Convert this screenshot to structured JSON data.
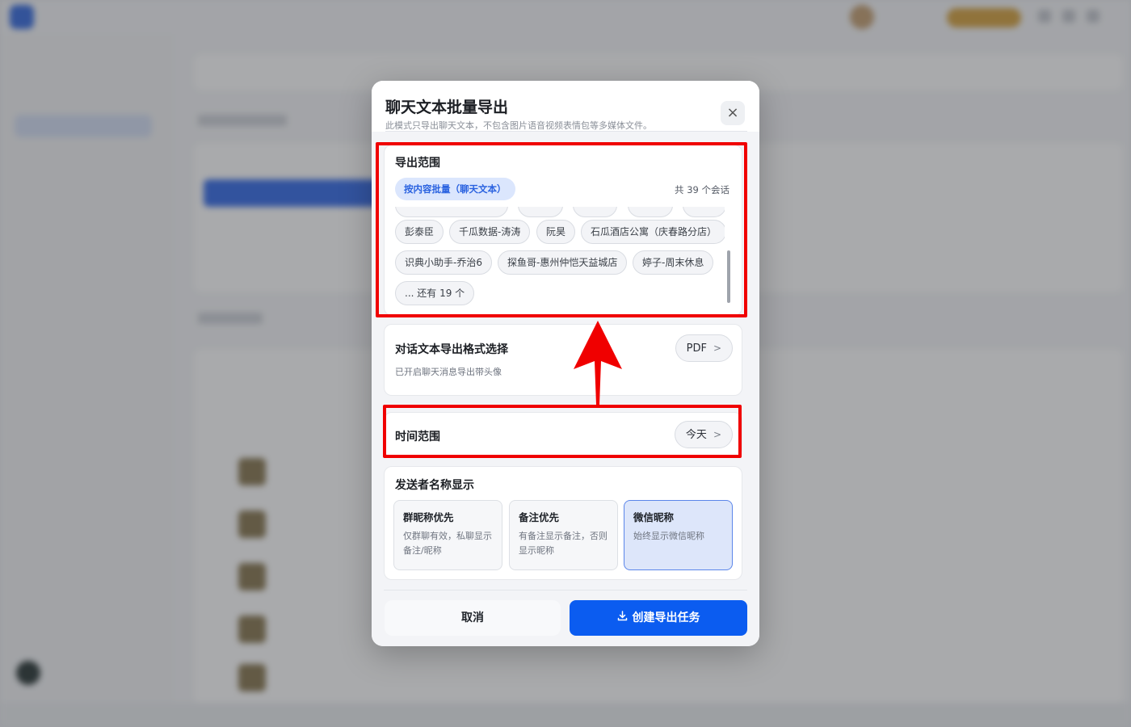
{
  "modal": {
    "title": "聊天文本批量导出",
    "subtitle": "此模式只导出聊天文本，不包含图片语音视频表情包等多媒体文件。",
    "close_icon": "×"
  },
  "export_range": {
    "title": "导出范围",
    "scope_label": "按内容批量（聊天文本）",
    "count_text": "共 39 个会话",
    "chips": [
      "彭泰臣",
      "千瓜数据-涛涛",
      "阮昊",
      "石瓜酒店公寓（庆春路分店）",
      "识典小助手-乔治6",
      "探鱼哥-惠州仲恺天益城店",
      "婷子-周末休息"
    ],
    "more_label": "... 还有 19 个"
  },
  "format": {
    "title": "对话文本导出格式选择",
    "desc": "已开启聊天消息导出带头像",
    "value": "PDF",
    "chevron": ">"
  },
  "time_range": {
    "title": "时间范围",
    "value": "今天",
    "chevron": ">"
  },
  "sender_name": {
    "title": "发送者名称显示",
    "options": [
      {
        "title": "群昵称优先",
        "desc": "仅群聊有效，私聊显示备注/昵称",
        "selected": false
      },
      {
        "title": "备注优先",
        "desc": "有备注显示备注，否则显示昵称",
        "selected": false
      },
      {
        "title": "微信昵称",
        "desc": "始终显示微信昵称",
        "selected": true
      }
    ]
  },
  "footer": {
    "cancel_label": "取消",
    "create_label": "创建导出任务",
    "create_icon": "download-icon"
  },
  "annotation": {
    "color": "#f00000"
  }
}
